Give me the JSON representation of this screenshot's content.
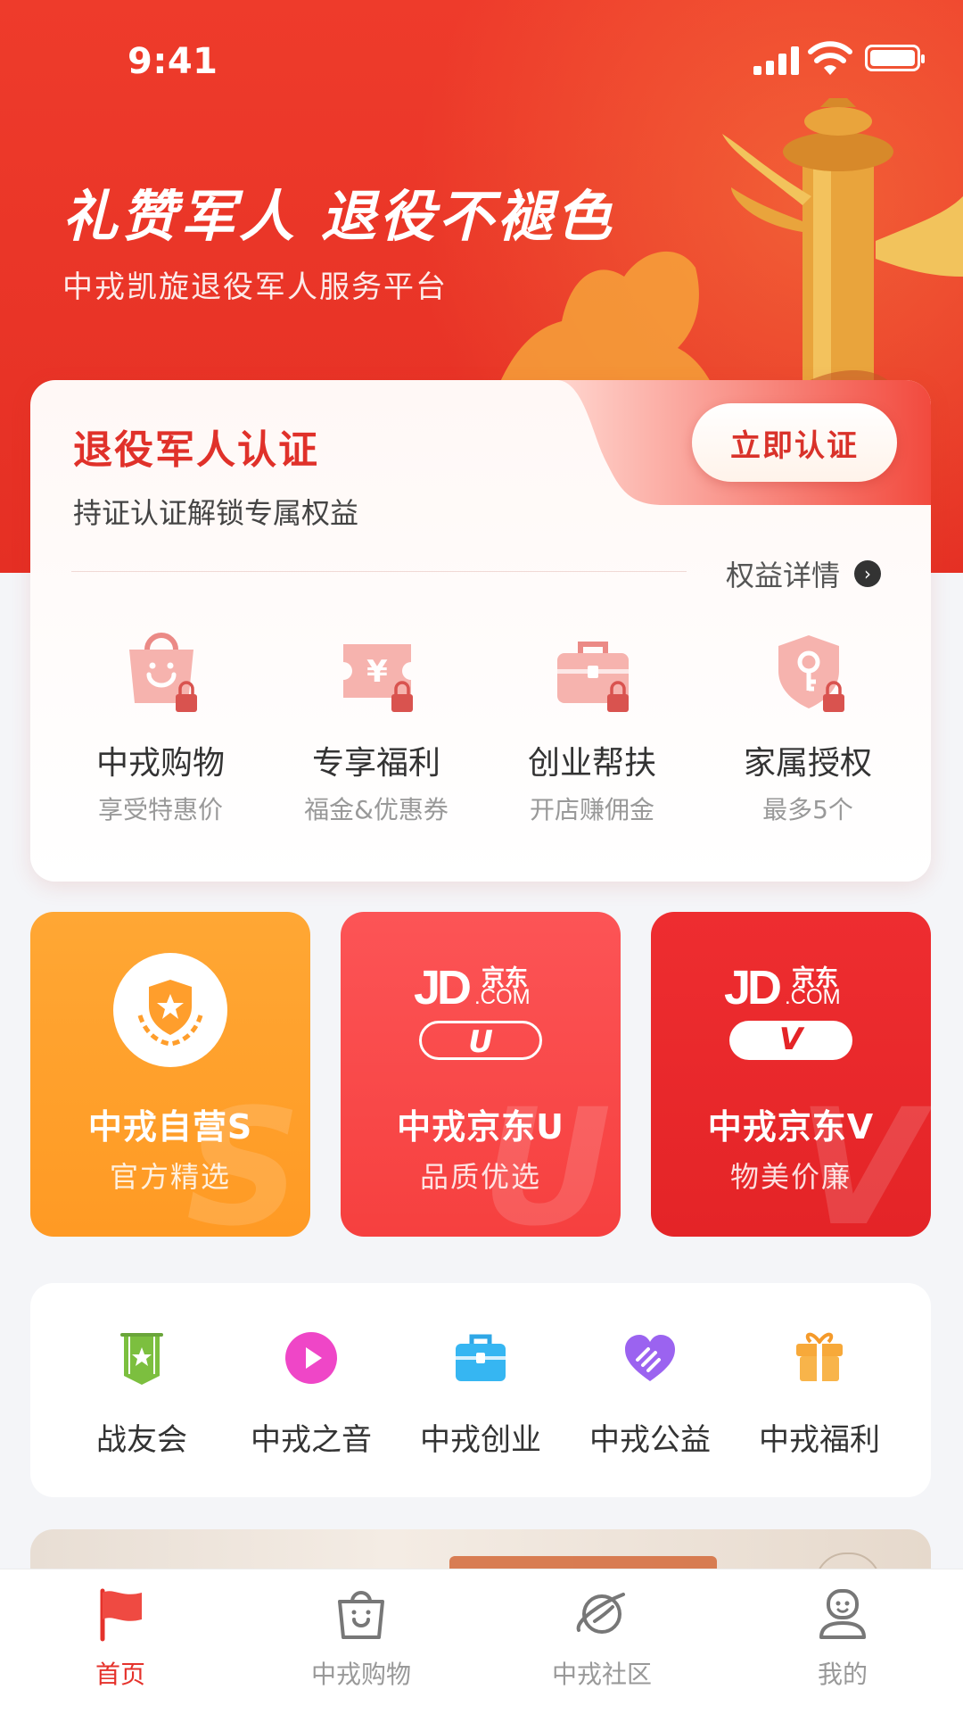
{
  "status_bar": {
    "time": "9:41"
  },
  "hero": {
    "title": "礼赞军人 退役不褪色",
    "subtitle": "中戎凯旋退役军人服务平台"
  },
  "certification": {
    "title": "退役军人认证",
    "description": "持证认证解锁专属权益",
    "button_label": "立即认证",
    "detail_link": "权益详情",
    "perks": [
      {
        "icon": "shopping-bag-lock-icon",
        "label": "中戎购物",
        "sub": "享受特惠价"
      },
      {
        "icon": "coupon-lock-icon",
        "label": "专享福利",
        "sub": "福金&优惠券"
      },
      {
        "icon": "briefcase-lock-icon",
        "label": "创业帮扶",
        "sub": "开店赚佣金"
      },
      {
        "icon": "shield-key-lock-icon",
        "label": "家属授权",
        "sub": "最多5个"
      }
    ]
  },
  "store_cards": [
    {
      "name": "中戎自营S",
      "tagline": "官方精选",
      "letter": "S",
      "color": "#ffa02a"
    },
    {
      "name": "中戎京东U",
      "tagline": "品质优选",
      "letter": "U",
      "color": "#f9484b",
      "logo": "JD",
      "logo_cn": "京东",
      "logo_domain": ".COM"
    },
    {
      "name": "中戎京东V",
      "tagline": "物美价廉",
      "letter": "V",
      "color": "#e9292c",
      "logo": "JD",
      "logo_cn": "京东",
      "logo_domain": ".COM"
    }
  ],
  "quick_links": [
    {
      "icon": "banner-flag-icon",
      "label": "战友会"
    },
    {
      "icon": "play-icon",
      "label": "中戎之音"
    },
    {
      "icon": "briefcase-icon",
      "label": "中戎创业"
    },
    {
      "icon": "heart-hand-icon",
      "label": "中戎公益"
    },
    {
      "icon": "gift-icon",
      "label": "中戎福利"
    }
  ],
  "tabbar": {
    "items": [
      {
        "icon": "flag-icon",
        "label": "首页",
        "active": true
      },
      {
        "icon": "shopping-bag-icon",
        "label": "中戎购物"
      },
      {
        "icon": "planet-icon",
        "label": "中戎社区"
      },
      {
        "icon": "profile-icon",
        "label": "我的"
      }
    ]
  },
  "colors": {
    "primary_red": "#e5322b",
    "orange": "#ffa02a",
    "bg": "#f4f5f8"
  }
}
